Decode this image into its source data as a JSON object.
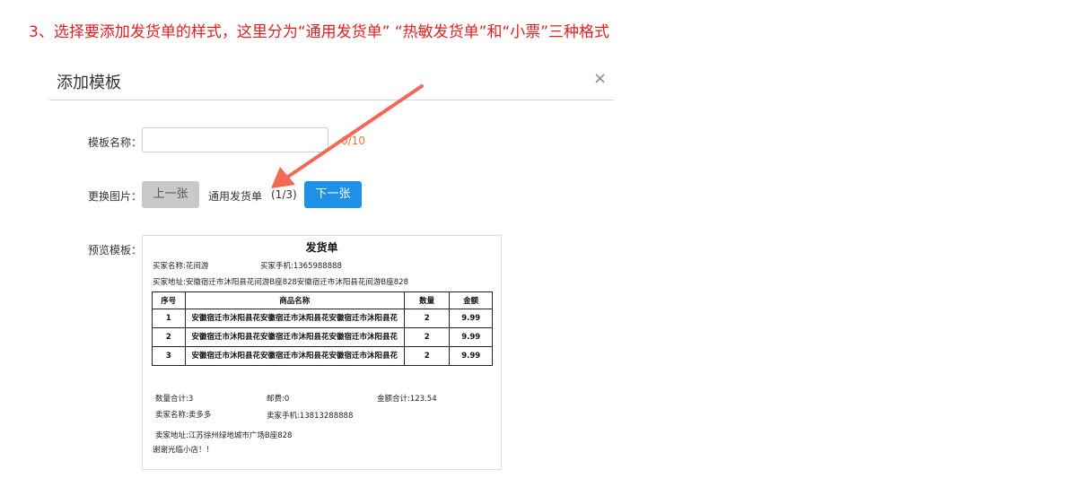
{
  "instruction": "3、选择要添加发货单的样式，这里分为“通用发货单” “热敏发货单”和“小票”三种格式",
  "dialog": {
    "title": "添加模板",
    "close_icon": "×"
  },
  "form": {
    "name_label": "模板名称：",
    "name_value": "",
    "name_counter": "0/10",
    "image_label": "更换图片：",
    "prev_button": "上一张",
    "template_type": "通用发货单",
    "template_page": "(1/3)",
    "next_button": "下一张",
    "preview_label": "预览模板："
  },
  "preview": {
    "title": "发货单",
    "buyer_name": "买家名称:花间游",
    "buyer_phone": "买家手机:1365988888",
    "buyer_address": "买家地址:安徽宿迁市沐阳县花间游B座828安徽宿迁市沐阳县花间游B座828",
    "columns": [
      "序号",
      "商品名称",
      "数量",
      "金额"
    ],
    "rows": [
      {
        "seq": "1",
        "name": "安徽宿迁市沐阳县花安徽宿迁市沐阳县花安徽宿迁市沐阳县花",
        "qty": "2",
        "amount": "9.99"
      },
      {
        "seq": "2",
        "name": "安徽宿迁市沐阳县花安徽宿迁市沐阳县花安徽宿迁市沐阳县花",
        "qty": "2",
        "amount": "9.99"
      },
      {
        "seq": "3",
        "name": "安徽宿迁市沐阳县花安徽宿迁市沐阳县花安徽宿迁市沐阳县花",
        "qty": "2",
        "amount": "9.99"
      }
    ],
    "total_qty": "数量合计:3",
    "postage": "邮费:0",
    "total_amount": "金额合计:123.54",
    "seller_name": "卖家名称:卖多多",
    "seller_phone": "卖家手机:13813288888",
    "seller_address": "卖家地址:江苏徐州绿地城市广场B座828",
    "thanks": "谢谢光临小店！！"
  },
  "colors": {
    "instruction": "#e02020",
    "next_button": "#1e90e6",
    "prev_button": "#c9c9c9",
    "counter": "#e8783a",
    "arrow": "#f06a55"
  },
  "icons": {
    "close": "close-icon",
    "annotation": "arrow-annotation-icon"
  }
}
